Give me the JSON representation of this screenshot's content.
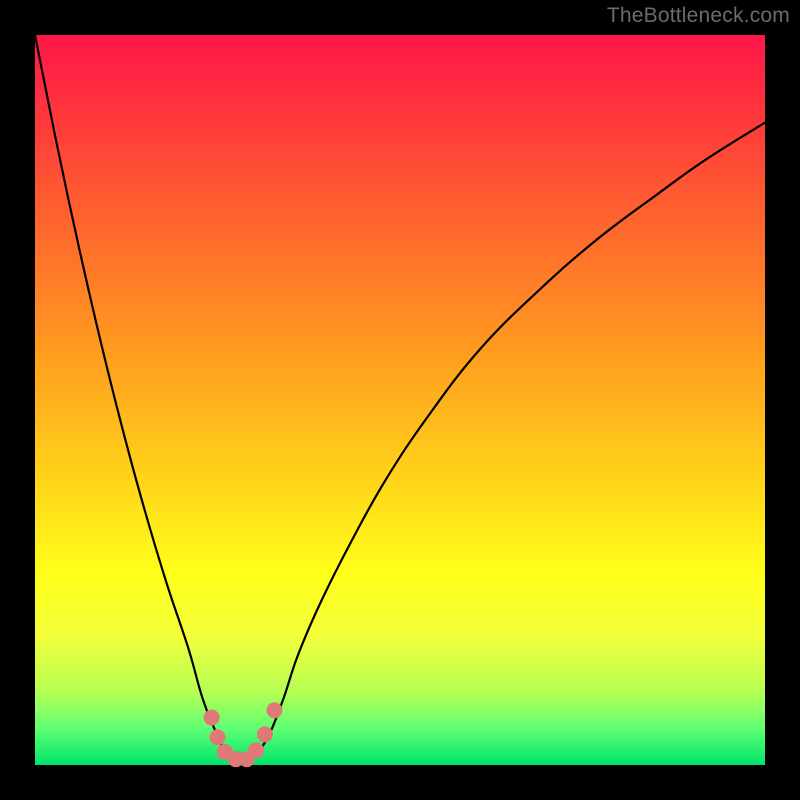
{
  "watermark": "TheBottleneck.com",
  "chart_data": {
    "type": "line",
    "title": "",
    "xlabel": "",
    "ylabel": "",
    "xlim": [
      0,
      100
    ],
    "ylim": [
      0,
      100
    ],
    "legend": null,
    "grid": false,
    "series": [
      {
        "name": "curve",
        "color": "#000000",
        "x": [
          0,
          3,
          6,
          9,
          12,
          15,
          18,
          21,
          23,
          25,
          26.5,
          28,
          29,
          30,
          32,
          34,
          36,
          39,
          43,
          48,
          54,
          61,
          69,
          77,
          85,
          92,
          100
        ],
        "y": [
          100,
          85,
          71,
          58,
          46,
          35,
          25,
          16,
          9,
          4,
          1,
          0,
          0,
          1,
          4,
          9,
          15,
          22,
          30,
          39,
          48,
          57,
          65,
          72,
          78,
          83,
          88
        ]
      }
    ],
    "markers": [
      {
        "x": 24.2,
        "y": 6.5,
        "color": "#e07878"
      },
      {
        "x": 25.0,
        "y": 3.8,
        "color": "#e07878"
      },
      {
        "x": 26.0,
        "y": 1.8,
        "color": "#e07878"
      },
      {
        "x": 27.5,
        "y": 0.8,
        "color": "#e07878"
      },
      {
        "x": 29.0,
        "y": 0.8,
        "color": "#e07878"
      },
      {
        "x": 30.3,
        "y": 2.0,
        "color": "#e07878"
      },
      {
        "x": 31.5,
        "y": 4.2,
        "color": "#e07878"
      },
      {
        "x": 32.8,
        "y": 7.5,
        "color": "#e07878"
      }
    ],
    "gradient_stops": [
      {
        "pos": 0,
        "color": "#ff1649"
      },
      {
        "pos": 12,
        "color": "#ff3a3b"
      },
      {
        "pos": 28,
        "color": "#ff6c2c"
      },
      {
        "pos": 44,
        "color": "#ff9e1f"
      },
      {
        "pos": 60,
        "color": "#ffd119"
      },
      {
        "pos": 74,
        "color": "#ffff1a"
      },
      {
        "pos": 82,
        "color": "#f4ff3a"
      },
      {
        "pos": 90,
        "color": "#b6ff53"
      },
      {
        "pos": 95,
        "color": "#5fff74"
      },
      {
        "pos": 100,
        "color": "#00e46b"
      }
    ]
  }
}
